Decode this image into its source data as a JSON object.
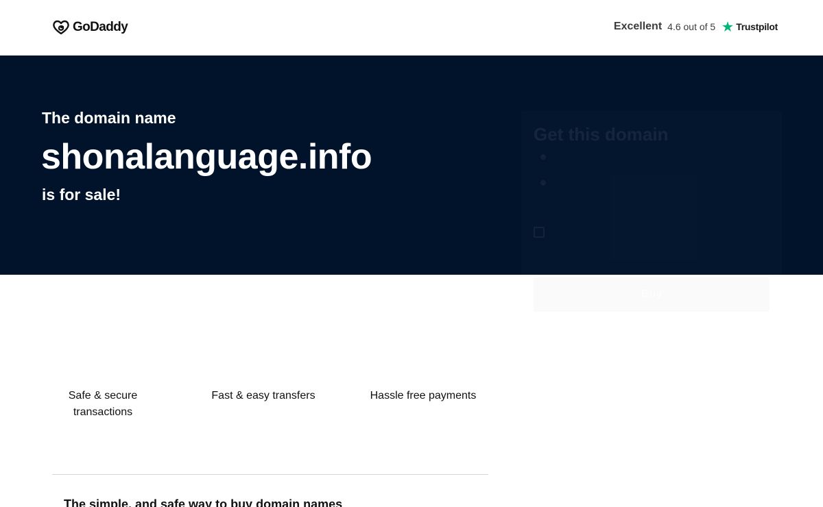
{
  "header": {
    "logo": {
      "text": "GoDaddy",
      "icon": "godaddy-logo-icon"
    },
    "rating": {
      "word": "Excellent",
      "score_text": "4.6 out of 5",
      "provider": "Trustpilot",
      "star_color": "#00b67a",
      "icon": "star-icon"
    }
  },
  "hero": {
    "background": "#00132b",
    "pre_text": "The domain name",
    "domain": "shonalanguage.info",
    "post_text": "is for sale!"
  },
  "card": {
    "title": "Get this domain",
    "line1": "",
    "line2": "",
    "option_label": "",
    "button_label": "Buy",
    "notes": [
      "",
      "",
      ""
    ]
  },
  "features": [
    {
      "label": "Safe & secure transactions"
    },
    {
      "label": "Fast & easy transfers"
    },
    {
      "label": "Hassle free payments"
    }
  ],
  "bottom": {
    "heading": "The simple, and safe way to buy domain names"
  }
}
